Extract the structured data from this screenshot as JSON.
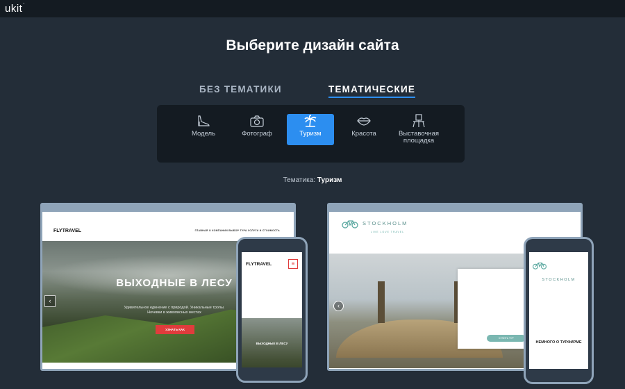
{
  "header": {
    "logo": "ukit",
    "logo_mark": "’"
  },
  "page": {
    "title": "Выберите дизайн сайта"
  },
  "tabs": [
    {
      "label": "БЕЗ ТЕМАТИКИ",
      "active": false
    },
    {
      "label": "ТЕМАТИЧЕСКИЕ",
      "active": true
    }
  ],
  "categories": [
    {
      "label": "Модель",
      "icon": "shoe-icon"
    },
    {
      "label": "Фотограф",
      "icon": "camera-icon"
    },
    {
      "label": "Туризм",
      "icon": "palm-icon",
      "active": true
    },
    {
      "label": "Красота",
      "icon": "lips-icon"
    },
    {
      "label": "Выставочная площадка",
      "icon": "exhibition-icon"
    }
  ],
  "theme": {
    "prefix": "Тематика:",
    "value": "Туризм"
  },
  "templates": [
    {
      "brand": "FLYTRAVEL",
      "nav": "ГЛАВНАЯ   О КОМПАНИИ   ВЫБОР ТУРА   УСЛУГИ И СТОИМОСТЬ",
      "hero_title": "ВЫХОДНЫЕ В ЛЕСУ",
      "hero_text": "Удивительное единение с природой. Уникальные тропы. Ночевки в живописных местах",
      "cta": "УЗНАТЬ КАК",
      "mobile_hero": "ВЫХОДНЫЕ В ЛЕСУ"
    },
    {
      "brand": "STOCKHOLM",
      "tagline": "LIVE LOVE TRAVEL",
      "cta": "КУПИТЬ ТУР",
      "mobile_heading": "НЕМНОГО О ТУРФИРМЕ"
    }
  ],
  "colors": {
    "accent": "#2c8ef0",
    "background": "#232d38",
    "panel": "#141b22",
    "cta_red": "#e03c3c",
    "teal": "#7ab7b1"
  }
}
